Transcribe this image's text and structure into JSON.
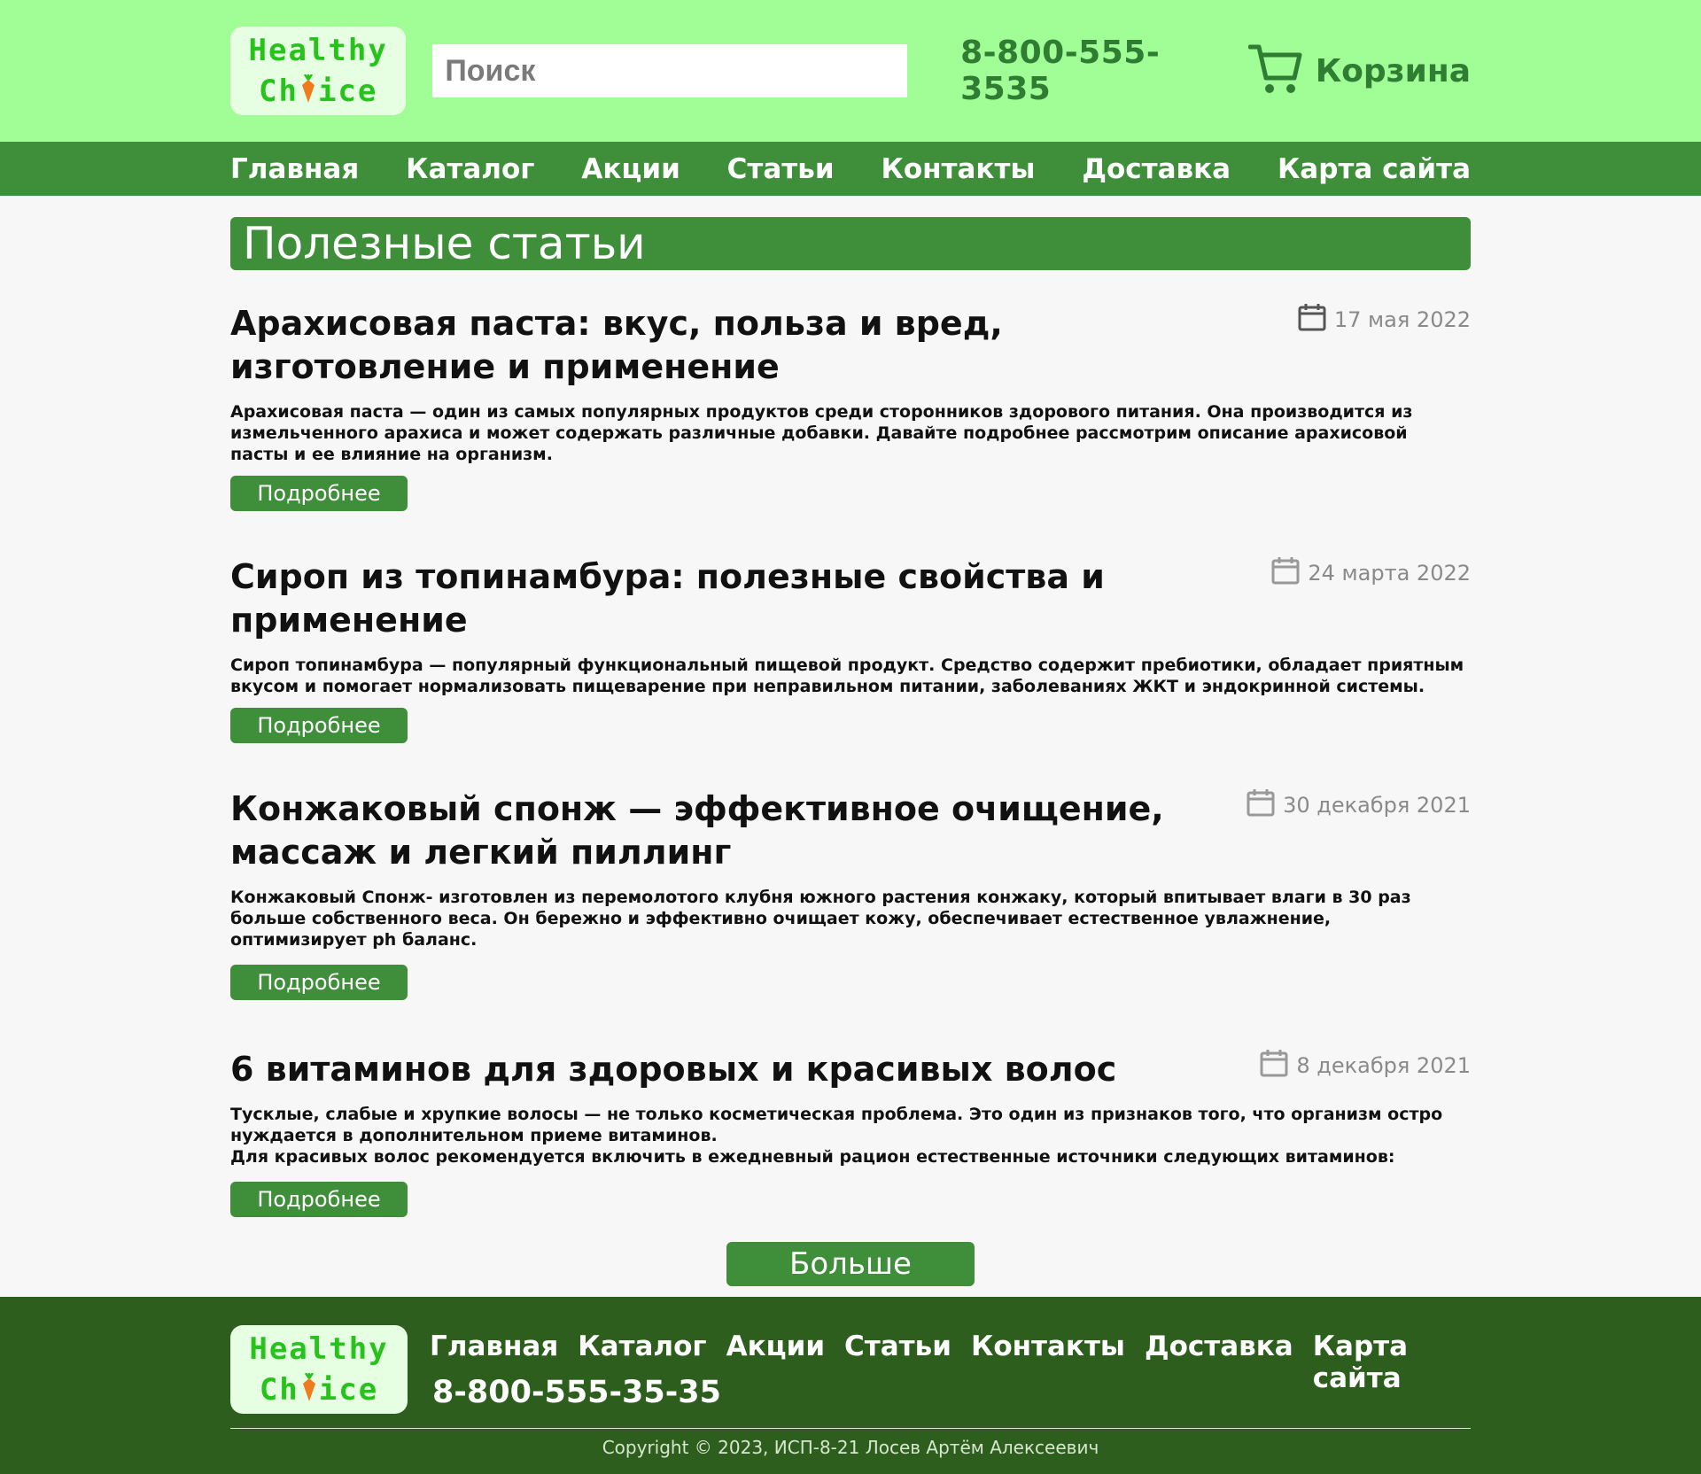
{
  "logo": {
    "line1": "Healthy",
    "line2_a": "Ch",
    "line2_b": "ice"
  },
  "search": {
    "placeholder": "Поиск"
  },
  "header": {
    "phone": "8-800-555-3535",
    "cart_label": "Корзина"
  },
  "nav": [
    "Главная",
    "Каталог",
    "Акции",
    "Статьи",
    "Контакты",
    "Доставка",
    "Карта сайта"
  ],
  "page_title": "Полезные статьи",
  "read_more_label": "Подробнее",
  "more_label": "Больше",
  "articles": [
    {
      "title": "Арахисовая паста: вкус, польза и вред, изготовление и применение",
      "date": "17 мая 2022",
      "text": "Арахисовая паста — один из самых популярных продуктов среди сторонников здорового питания. Она производится из измельченного арахиса и может содержать различные добавки. Давайте подробнее рассмотрим описание арахисовой пасты и ее влияние на организм."
    },
    {
      "title": "Сироп из топинамбура: полезные свойства и применение",
      "date": "24 марта 2022",
      "text": "Сироп топинамбура — популярный функциональный пищевой продукт. Средство содержит пребиотики, обладает приятным вкусом и помогает нормализовать пищеварение при неправильном питании, заболеваниях ЖКТ и эндокринной системы."
    },
    {
      "title": "Конжаковый спонж — эффективное очищение, массаж и легкий пиллинг",
      "date": "30 декабря 2021",
      "text": "Конжаковый Спонж- изготовлен из перемолотого клубня южного растения конжаку, который впитывает влаги в 30 раз больше собственного веса. Он бережно и эффективно очищает кожу, обеспечивает естественное увлажнение, оптимизирует ph баланс."
    },
    {
      "title": "6 витаминов для здоровых и красивых волос",
      "date": "8 декабря 2021",
      "text": "Тусклые, слабые и хрупкие волосы — не только косметическая проблема. Это один из признаков того, что организм остро нуждается в дополнительном приеме витаминов.",
      "text2": "Для красивых волос рекомендуется включить в ежедневный рацион естественные источники следующих витаминов:"
    }
  ],
  "footer": {
    "nav": [
      "Главная",
      "Каталог",
      "Акции",
      "Статьи",
      "Контакты",
      "Доставка",
      "Карта сайта"
    ],
    "phone": "8-800-555-35-35",
    "copyright": "Copyright © 2023, ИСП-8-21 Лосев Артём Алексеевич"
  },
  "colors": {
    "header_bg": "#a1fd95",
    "accent": "#3e8e3a",
    "footer_bg": "#2e5e1e",
    "logo_text": "#27c31c"
  },
  "icons": [
    "cart-icon",
    "calendar-icon",
    "carrot-icon"
  ]
}
